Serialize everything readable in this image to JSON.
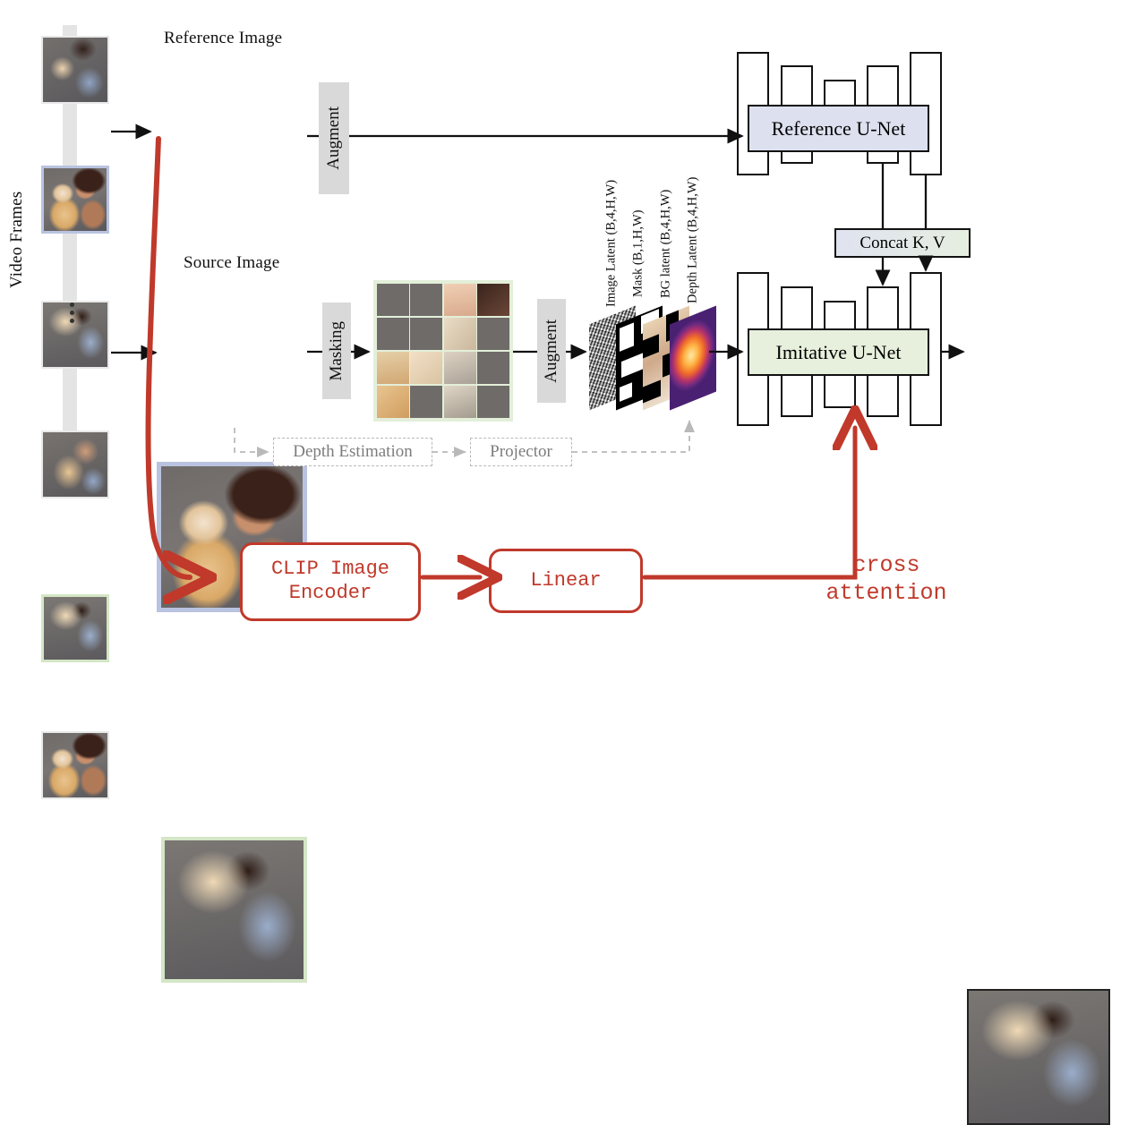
{
  "figure": {
    "type": "architecture-diagram",
    "title": "Imitative video-to-image editing pipeline"
  },
  "left": {
    "video_frames_label": "Video Frames",
    "frames": [
      {
        "index": 1,
        "highlight": "none"
      },
      {
        "index": 2,
        "highlight": "reference"
      },
      {
        "index": 3,
        "highlight": "none"
      },
      {
        "index": 4,
        "highlight": "none"
      },
      {
        "index": 5,
        "highlight": "source"
      },
      {
        "index": 6,
        "highlight": "none"
      }
    ],
    "ellipsis": "⋮"
  },
  "reference": {
    "caption": "Reference Image",
    "border_color": "#b9c3e0"
  },
  "source": {
    "caption": "Source Image",
    "border_color": "#d4e6c6"
  },
  "operations": {
    "augment_top": "Augment",
    "augment_bottom": "Augment",
    "masking": "Masking",
    "depth_estimation": "Depth Estimation",
    "projector": "Projector"
  },
  "mask_grid": {
    "rows": 4,
    "cols": 4,
    "masked_color": "#6f6b69",
    "pattern": [
      [
        1,
        1,
        0,
        0
      ],
      [
        1,
        1,
        0,
        1
      ],
      [
        0,
        0,
        0,
        1
      ],
      [
        0,
        1,
        0,
        1
      ]
    ]
  },
  "latents": [
    {
      "name": "Image Latent",
      "shape": "(B,4,H,W)",
      "kind": "noise"
    },
    {
      "name": "Mask",
      "shape": "(B,1,H,W)",
      "kind": "mask"
    },
    {
      "name": "BG latent",
      "shape": "(B,4,H,W)",
      "kind": "background"
    },
    {
      "name": "Depth Latent",
      "shape": "(B,4,H,W)",
      "kind": "depth"
    }
  ],
  "networks": {
    "reference_unet": "Reference U-Net",
    "imitative_unet": "Imitative U-Net",
    "concat": "Concat K, V",
    "reference_unet_color": "#dde0ee",
    "imitative_unet_color": "#e7f0dc"
  },
  "conditioning": {
    "clip_encoder_line1": "CLIP Image",
    "clip_encoder_line2": "Encoder",
    "linear": "Linear",
    "cross_attention_line1": "cross",
    "cross_attention_line2": "attention",
    "accent_color": "#c0392b"
  },
  "output": {
    "label": ""
  }
}
